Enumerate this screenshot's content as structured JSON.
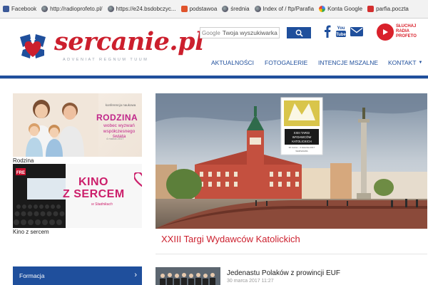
{
  "bookmarks": [
    {
      "label": "Facebook",
      "icon": "facebook-icon"
    },
    {
      "label": "http://radioprofeto.pl/",
      "icon": "globe-icon"
    },
    {
      "label": "https://e24.bsdobczyc...",
      "icon": "globe-icon"
    },
    {
      "label": "podstawoa",
      "icon": "plus-icon"
    },
    {
      "label": "średnia",
      "icon": "globe-icon"
    },
    {
      "label": "Index of / ftp/Parafia",
      "icon": "globe-icon"
    },
    {
      "label": "Konta Google",
      "icon": "google-icon"
    },
    {
      "label": "parfia.poczta",
      "icon": "pocket-icon"
    }
  ],
  "header": {
    "logo_text": "sercanie.pl",
    "logo_tagline": "ADVENIAT REGNUM TUUM",
    "search_brand": "Google",
    "search_placeholder": "Twoja wyszukiwarka",
    "radio_label_1": "SŁUCHAJ",
    "radio_label_2": "RADIA",
    "radio_label_3": "PROFETO"
  },
  "nav": {
    "items": [
      "AKTUALNOŚCI",
      "FOTOGALERIE",
      "INTENCJE MSZALNE",
      "KONTAKT"
    ]
  },
  "banners": {
    "rodzina": {
      "small": "konferencja naukowa",
      "title": "RODZINA",
      "subtitle_1": "wobec wyzwań",
      "subtitle_2": "współczesnego świata",
      "date": "4 marca 2017",
      "caption": "Rodzina"
    },
    "kino": {
      "title_1": "KINO",
      "title_2": "Z SERCEM",
      "small": "w Stadnikach",
      "caption": "Kino z sercem"
    }
  },
  "featured": {
    "poster_line_1": "XXIII TARGI",
    "poster_line_2": "WYDAWCÓW",
    "poster_line_3": "KATOLICKICH",
    "poster_date": "30 marca – 2 kwietnia 2017",
    "poster_city": "WARSZAWA",
    "caption": "XXIII Targi Wydawców Katolickich"
  },
  "sidebar": {
    "formacja_label": "Formacja"
  },
  "news": [
    {
      "title": "Jedenastu Polaków z prowincji EUF",
      "date": "30 marca 2017 11:27"
    }
  ],
  "colors": {
    "brand_red": "#cc1f2d",
    "brand_blue": "#1f4f9c",
    "pink": "#c0268a"
  }
}
